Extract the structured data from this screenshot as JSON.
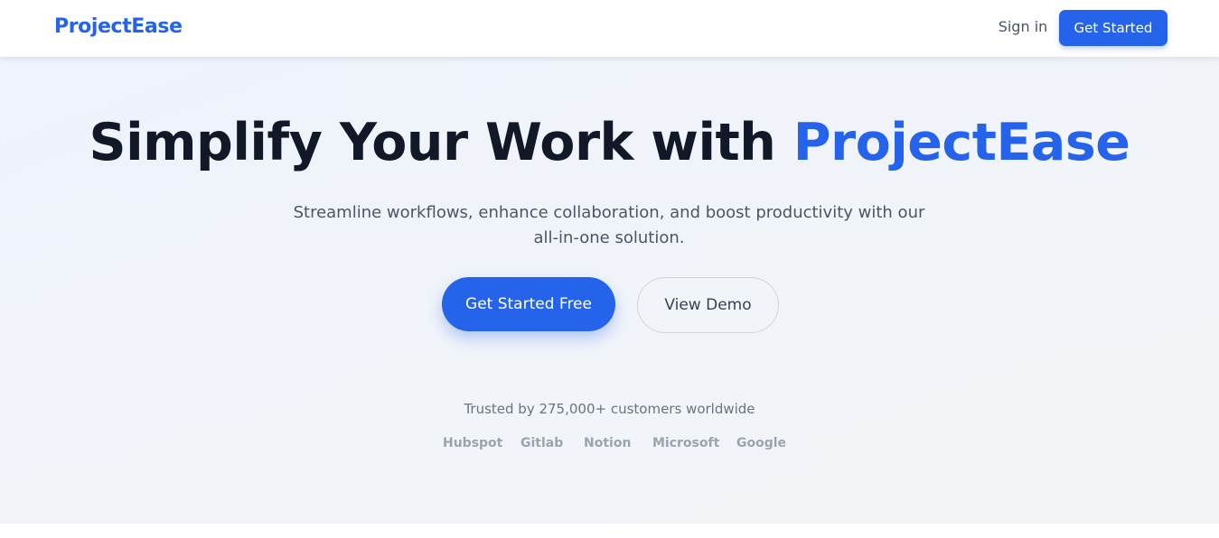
{
  "header": {
    "logo": "ProjectEase",
    "signin_label": "Sign in",
    "cta_label": "Get Started"
  },
  "hero": {
    "title_main": "Simplify Your Work with ",
    "title_accent": "ProjectEase",
    "subtitle": "Streamline workflows, enhance collaboration, and boost productivity with our all-in-one solution.",
    "primary_label": "Get Started Free",
    "secondary_label": "View Demo"
  },
  "trust": {
    "text": "Trusted by 275,000+ customers worldwide",
    "brands": [
      "Hubspot",
      "Gitlab",
      "Notion",
      "Microsoft",
      "Google"
    ]
  },
  "colors": {
    "brand": "#2563eb",
    "heading": "#111827",
    "body_text": "#4b5563",
    "muted": "#9ca3af",
    "hero_background": "#eef3fc"
  }
}
